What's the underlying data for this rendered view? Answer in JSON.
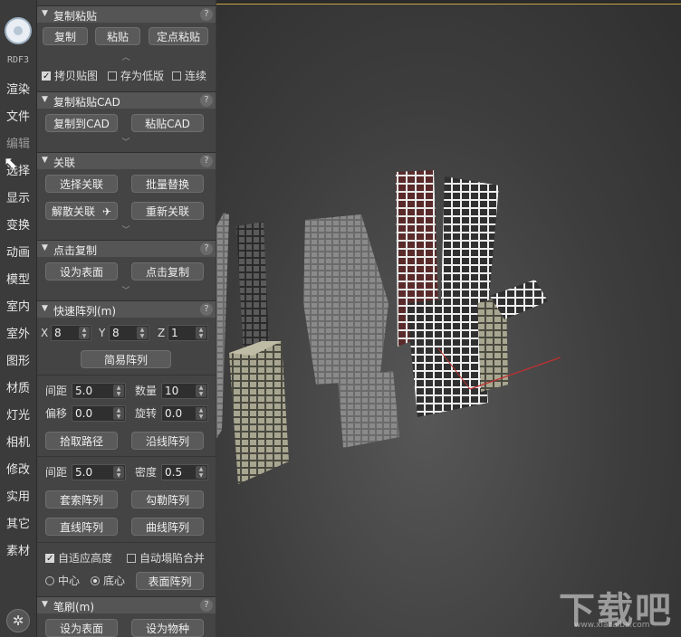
{
  "sidebar": {
    "version": "RDF3",
    "items": [
      "渲染",
      "文件",
      "编辑",
      "选择",
      "显示",
      "变换",
      "动画",
      "模型",
      "室内",
      "室外",
      "图形",
      "材质",
      "灯光",
      "相机",
      "修改",
      "实用",
      "其它",
      "素材"
    ]
  },
  "copy_paste": {
    "title": "复制粘贴",
    "help": "?",
    "copy": "复制",
    "paste": "粘贴",
    "fixed_paste": "定点粘贴",
    "chk_copy_map": "拷贝贴图",
    "chk_low_ver": "存为低版",
    "chk_continuous": "连续"
  },
  "copy_paste_cad": {
    "title": "复制粘贴CAD",
    "help": "?",
    "copy_to_cad": "复制到CAD",
    "paste_cad": "粘贴CAD"
  },
  "link": {
    "title": "关联",
    "help": "?",
    "select_link": "选择关联",
    "batch_replace": "批量替换",
    "unlink": "解散关联",
    "relink": "重新关联"
  },
  "click_copy": {
    "title": "点击复制",
    "help": "?",
    "set_surface": "设为表面",
    "click_copy": "点击复制"
  },
  "quick_array": {
    "title": "快速阵列(m)",
    "help": "?",
    "x_label": "X",
    "x_value": "8",
    "y_label": "Y",
    "y_value": "8",
    "z_label": "Z",
    "z_value": "1",
    "simple_array": "简易阵列",
    "spacing_label": "间距",
    "spacing_value": "5.0",
    "count_label": "数量",
    "count_value": "10",
    "offset_label": "偏移",
    "offset_value": "0.0",
    "rotate_label": "旋转",
    "rotate_value": "0.0",
    "pick_path": "拾取路径",
    "along_line_array": "沿线阵列",
    "spacing2_label": "间距",
    "spacing2_value": "5.0",
    "density_label": "密度",
    "density_value": "0.5",
    "lasso_array": "套索阵列",
    "outline_array": "勾勒阵列",
    "line_array": "直线阵列",
    "curve_array": "曲线阵列",
    "chk_adaptive_height": "自适应高度",
    "chk_auto_merge": "自动塌陷合并",
    "radio_center": "中心",
    "radio_bottom": "底心",
    "surface_array": "表面阵列"
  },
  "brush": {
    "title": "笔刷(m)",
    "help": "?",
    "set_surface": "设为表面",
    "set_species": "设为物种"
  },
  "watermark": {
    "brand": "下载吧",
    "url": "www.xiazaiba.com"
  }
}
